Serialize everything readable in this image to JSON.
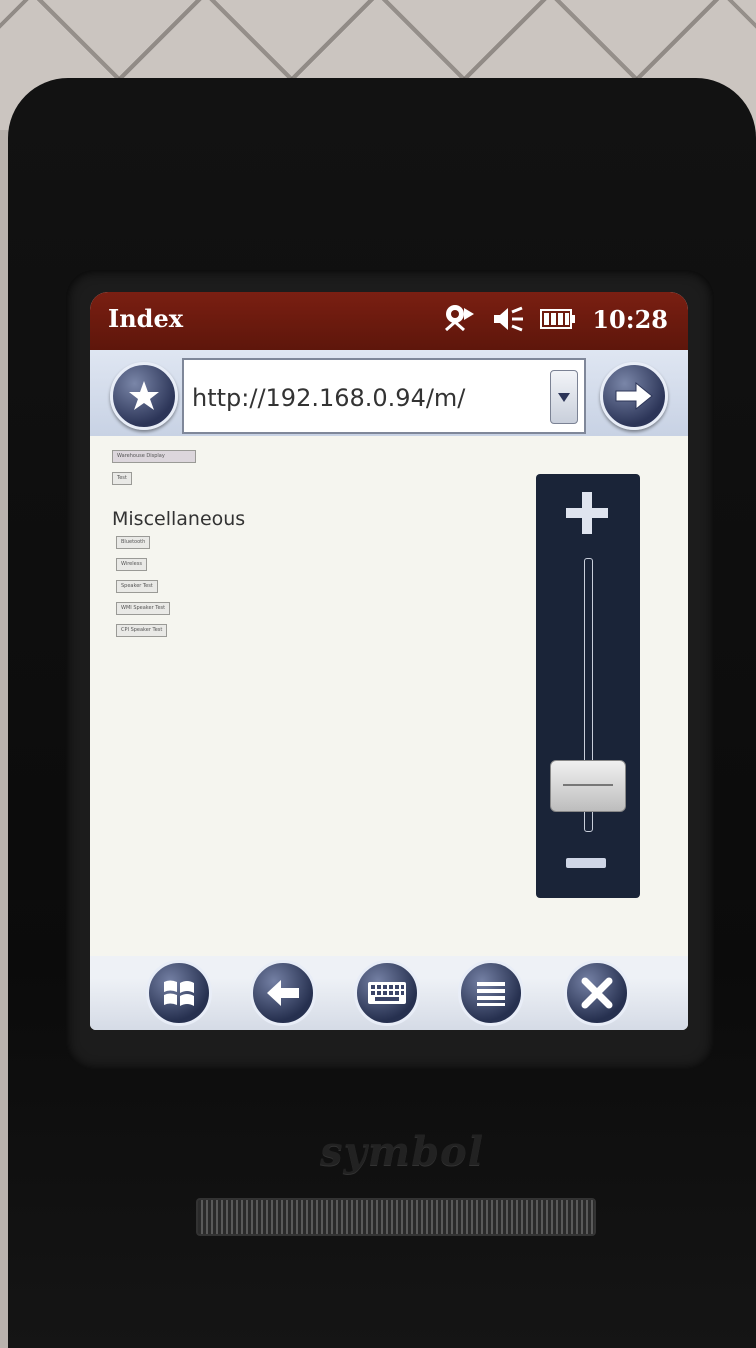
{
  "window": {
    "title": "Index",
    "clock": "10:28"
  },
  "status_icons": [
    "connectivity-icon",
    "speaker-muted-icon",
    "battery-icon"
  ],
  "address_bar": {
    "url": "http://192.168.0.94/m/"
  },
  "content": {
    "heading": "Miscellaneous",
    "top_buttons": [
      "Warehouse Display",
      "Test"
    ],
    "buttons": [
      "Bluetooth",
      "Wireless",
      "Speaker Test",
      "WMI Speaker Test",
      "CPI Speaker Test"
    ]
  },
  "zoom": {
    "level": 0.25
  },
  "bottom_bar": [
    "windows-start-icon",
    "back-arrow-icon",
    "keyboard-icon",
    "menu-icon",
    "close-icon"
  ],
  "device": {
    "brand": "symbol"
  },
  "colors": {
    "title_bar": "#6a1a0e",
    "button_navy": "#2c3558",
    "screen_bg": "#f4f4ef"
  }
}
